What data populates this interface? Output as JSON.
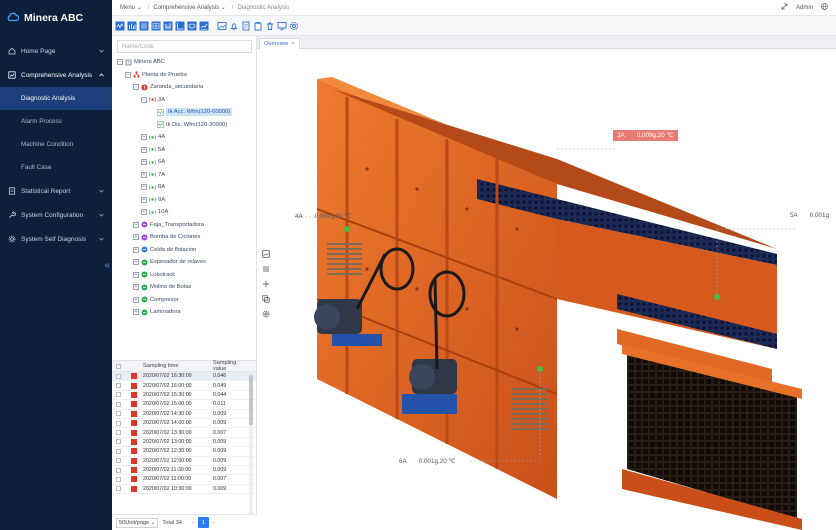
{
  "app": {
    "title": "Minera ABC"
  },
  "sidebar": {
    "items": [
      {
        "label": "Home Page",
        "icon": "home-icon",
        "expanded": false
      },
      {
        "label": "Comprehensive Analysis",
        "icon": "chart-box-icon",
        "expanded": true,
        "children": [
          {
            "label": "Diagnostic Analysis",
            "active": true
          },
          {
            "label": "Alarm Process"
          },
          {
            "label": "Machine Condition"
          },
          {
            "label": "Fault Case"
          }
        ]
      },
      {
        "label": "Statistical Report",
        "icon": "report-icon",
        "expanded": false
      },
      {
        "label": "System Configuration",
        "icon": "wrench-icon",
        "expanded": false
      },
      {
        "label": "System Self Diagnosis",
        "icon": "gear-icon",
        "expanded": false
      }
    ]
  },
  "topbar": {
    "crumbs": [
      "Menu",
      "Comprehensive Analysis",
      "Diagnostic Analysis"
    ],
    "user": "Admin"
  },
  "tree": {
    "search_placeholder": "Name/Code",
    "rows": [
      {
        "label": "Minera ABC",
        "depth": 0,
        "toggle": "−",
        "icon": "building-icon"
      },
      {
        "label": "Planta de Prueba",
        "depth": 1,
        "toggle": "−",
        "icon": "org-icon"
      },
      {
        "label": "Zaranda_secundaria",
        "depth": 2,
        "toggle": "−",
        "icon": "alert-red-icon"
      },
      {
        "label": "3A",
        "depth": 3,
        "toggle": "−",
        "icon": "sensor-red-icon"
      },
      {
        "label": "Ik Acc. Wfm(120-60000)",
        "depth": 4,
        "toggle": "",
        "icon": "waveform-icon",
        "selected": true
      },
      {
        "label": "Ik Dis. Wfm(120-30000)",
        "depth": 4,
        "toggle": "",
        "icon": "waveform-icon"
      },
      {
        "label": "4A",
        "depth": 3,
        "toggle": "+",
        "icon": "sensor-green-icon"
      },
      {
        "label": "5A",
        "depth": 3,
        "toggle": "+",
        "icon": "sensor-green-icon"
      },
      {
        "label": "6A",
        "depth": 3,
        "toggle": "+",
        "icon": "sensor-green-icon"
      },
      {
        "label": "7A",
        "depth": 3,
        "toggle": "+",
        "icon": "sensor-green-icon"
      },
      {
        "label": "8A",
        "depth": 3,
        "toggle": "+",
        "icon": "sensor-green-icon"
      },
      {
        "label": "9A",
        "depth": 3,
        "toggle": "+",
        "icon": "sensor-green-icon"
      },
      {
        "label": "10A",
        "depth": 3,
        "toggle": "+",
        "icon": "sensor-green-icon"
      },
      {
        "label": "Faja_Transportadora",
        "depth": 2,
        "toggle": "+",
        "icon": "device-purple-icon"
      },
      {
        "label": "Bomba de Ciclones",
        "depth": 2,
        "toggle": "+",
        "icon": "device-purple-icon"
      },
      {
        "label": "Celda de flotacion",
        "depth": 2,
        "toggle": "+",
        "icon": "device-blue-icon"
      },
      {
        "label": "Espesador de relaves",
        "depth": 2,
        "toggle": "+",
        "icon": "device-green-icon"
      },
      {
        "label": "Lokotrack",
        "depth": 2,
        "toggle": "+",
        "icon": "device-green-icon"
      },
      {
        "label": "Molino de Bolas",
        "depth": 2,
        "toggle": "+",
        "icon": "device-green-icon"
      },
      {
        "label": "Compresor",
        "depth": 2,
        "toggle": "+",
        "icon": "device-green-icon"
      },
      {
        "label": "Laminadora",
        "depth": 2,
        "toggle": "+",
        "icon": "device-green-icon"
      }
    ]
  },
  "table": {
    "headers": {
      "time": "Sampling time",
      "value": "Sampling value"
    },
    "rows": [
      {
        "time": "2020/07/02 16:30:00",
        "value": "0.046"
      },
      {
        "time": "2020/07/02 16:00:00",
        "value": "0.049"
      },
      {
        "time": "2020/07/02 15:30:00",
        "value": "0.044"
      },
      {
        "time": "2020/07/02 15:00:00",
        "value": "0.011"
      },
      {
        "time": "2020/07/02 14:30:00",
        "value": "0.009"
      },
      {
        "time": "2020/07/02 14:00:00",
        "value": "0.009"
      },
      {
        "time": "2020/07/02 13:30:00",
        "value": "0.007"
      },
      {
        "time": "2020/07/02 13:00:00",
        "value": "0.009"
      },
      {
        "time": "2020/07/02 12:30:00",
        "value": "0.009"
      },
      {
        "time": "2020/07/02 12:00:00",
        "value": "0.009"
      },
      {
        "time": "2020/07/02 11:30:00",
        "value": "0.009"
      },
      {
        "time": "2020/07/02 11:00:00",
        "value": "0.007"
      },
      {
        "time": "2020/07/02 10:30:00",
        "value": "0.009"
      }
    ],
    "page_size": "50Unit/page",
    "total": "Total 34",
    "current_page": "1"
  },
  "main": {
    "tab_label": "Overview",
    "sensors": [
      {
        "id": "3A",
        "value": "0.009g,20 ℃",
        "alarm": true
      },
      {
        "id": "4A",
        "value": "0.001g,20 ℃"
      },
      {
        "id": "5A",
        "value": "0.001g"
      },
      {
        "id": "6A",
        "value": "0.001g,20 ℃"
      }
    ]
  },
  "colors": {
    "sidebar_bg": "#0c1f3b",
    "sidebar_active": "#1c3f7a",
    "accent": "#2d7cf6",
    "alarm": "#e0352b",
    "machine_orange": "#e8621e"
  }
}
